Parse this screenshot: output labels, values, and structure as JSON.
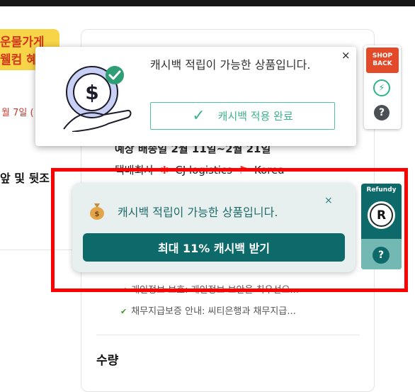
{
  "left_page": {
    "promo_line1": "운물가게",
    "promo_line2": "웰컴 혜",
    "date_text": "월 7일 (",
    "heading": "앞 및 뒷조"
  },
  "product_panel": {
    "shipping_row": "예상 배송일 2월 11일~2월 21일",
    "carrier_label": "택배회사",
    "carrier_name": "CJ logistics",
    "carrier_extra": "Korea",
    "checks": [
      "개인정보 보호: 개인정보 보안을 최우선으...",
      "채무지급보증 안내: 씨티은행과 채무지급..."
    ],
    "quantity_label": "수량"
  },
  "shopback": {
    "popup_text": "캐시백 적립이 가능한 상품입니다.",
    "close_glyph": "×",
    "button_label": "캐시백 적용 완료",
    "logo_line1": "SHOP",
    "logo_line2": "BACK",
    "help_glyph": "?"
  },
  "refundy": {
    "popup_text": "캐시백 적립이 가능한 상품입니다.",
    "close_glyph": "×",
    "button_label": "최대 11% 캐시백 받기",
    "brand": "Refundy",
    "logo_letter": "R",
    "help_glyph": "?"
  },
  "colors": {
    "shopback_accent": "#3fb28f",
    "shopback_brand": "#e24a2a",
    "refundy_teal": "#0e6a6a",
    "highlight_red": "#ff0000"
  },
  "icons": [
    "money-hand-icon",
    "check-badge-icon",
    "checkmark-icon",
    "bolt-icon",
    "help-icon",
    "money-bag-icon",
    "refundy-logo-icon",
    "close-icon"
  ]
}
